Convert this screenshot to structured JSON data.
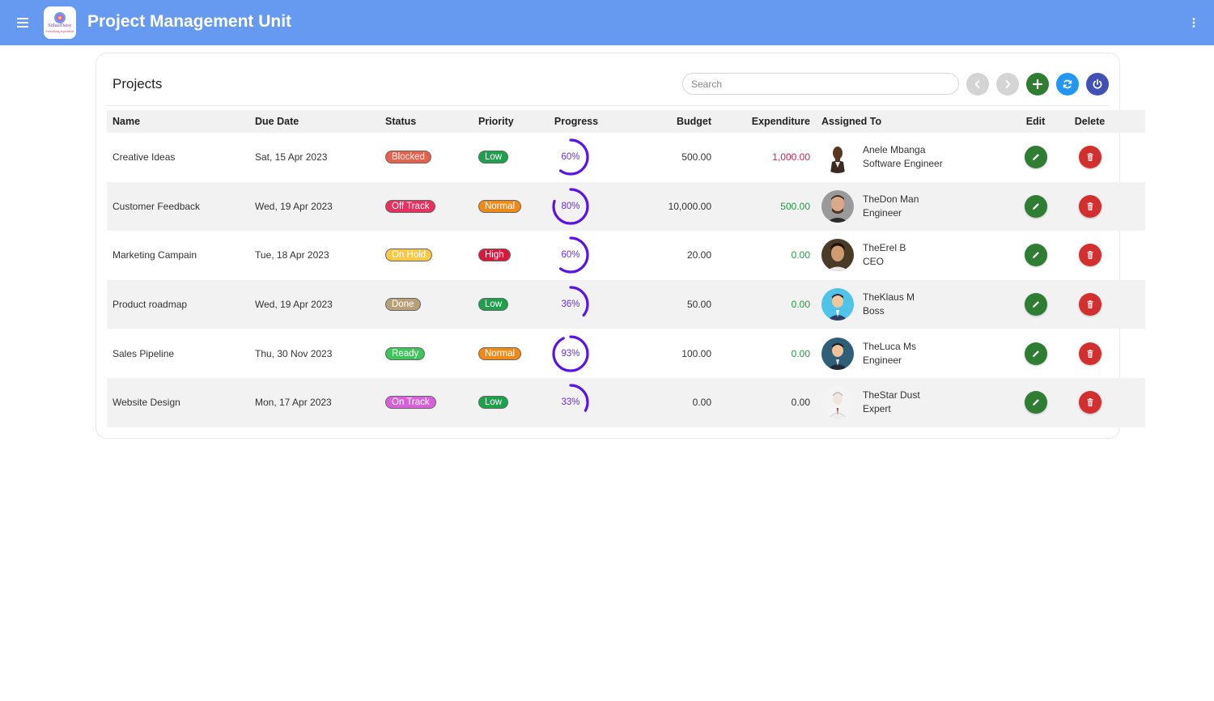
{
  "app": {
    "title": "Project Management Unit",
    "logo_text": "SithaoDaisy",
    "logo_sub": "everything is possible"
  },
  "projects": {
    "title": "Projects",
    "search_placeholder": "Search",
    "toolbar": [
      {
        "name": "prev-page-button",
        "icon": "chevron-left-icon",
        "color": "#d4d4d4"
      },
      {
        "name": "next-page-button",
        "icon": "chevron-right-icon",
        "color": "#d4d4d4"
      },
      {
        "name": "add-project-button",
        "icon": "plus-icon",
        "color": "#2e7d32"
      },
      {
        "name": "refresh-button",
        "icon": "refresh-icon",
        "color": "#2196f3"
      },
      {
        "name": "power-button",
        "icon": "power-icon",
        "color": "#3f51b5"
      }
    ],
    "columns": {
      "name": "Name",
      "due": "Due Date",
      "status": "Status",
      "priority": "Priority",
      "progress": "Progress",
      "budget": "Budget",
      "expenditure": "Expenditure",
      "assigned": "Assigned To",
      "edit": "Edit",
      "delete": "Delete"
    },
    "rows": [
      {
        "name": "Creative Ideas",
        "due": "Sat, 15 Apr 2023",
        "status": {
          "label": "Blocked",
          "color": "#e8604c"
        },
        "priority": {
          "label": "Low",
          "color": "#1aa34a"
        },
        "progress": 60,
        "progress_label": "60%",
        "budget": "500.00",
        "expenditure": "1,000.00",
        "exp_tone": "neg",
        "assignee": {
          "name": "Anele Mbanga",
          "role": "Software Engineer",
          "avatar": "avatar-1"
        }
      },
      {
        "name": "Customer Feedback",
        "due": "Wed, 19 Apr 2023",
        "status": {
          "label": "Off Track",
          "color": "#e8305e"
        },
        "priority": {
          "label": "Normal",
          "color": "#f08a14"
        },
        "progress": 80,
        "progress_label": "80%",
        "budget": "10,000.00",
        "expenditure": "500.00",
        "exp_tone": "pos",
        "assignee": {
          "name": "TheDon Man",
          "role": "Engineer",
          "avatar": "avatar-2"
        }
      },
      {
        "name": "Marketing Campain",
        "due": "Tue, 18 Apr 2023",
        "status": {
          "label": "On Hold",
          "color": "#f7c948"
        },
        "priority": {
          "label": "High",
          "color": "#d9183e"
        },
        "progress": 60,
        "progress_label": "60%",
        "budget": "20.00",
        "expenditure": "0.00",
        "exp_tone": "pos",
        "assignee": {
          "name": "TheErel B",
          "role": "CEO",
          "avatar": "avatar-3"
        }
      },
      {
        "name": "Product roadmap",
        "due": "Wed, 19 Apr 2023",
        "status": {
          "label": "Done",
          "color": "#b8a07a"
        },
        "priority": {
          "label": "Low",
          "color": "#1aa34a"
        },
        "progress": 36,
        "progress_label": "36%",
        "budget": "50.00",
        "expenditure": "0.00",
        "exp_tone": "pos",
        "assignee": {
          "name": "TheKlaus M",
          "role": "Boss",
          "avatar": "avatar-4"
        }
      },
      {
        "name": "Sales Pipeline",
        "due": "Thu, 30 Nov 2023",
        "status": {
          "label": "Ready",
          "color": "#3ec45a"
        },
        "priority": {
          "label": "Normal",
          "color": "#f08a14"
        },
        "progress": 93,
        "progress_label": "93%",
        "budget": "100.00",
        "expenditure": "0.00",
        "exp_tone": "pos",
        "assignee": {
          "name": "TheLuca Ms",
          "role": "Engineer",
          "avatar": "avatar-5"
        }
      },
      {
        "name": "Website Design",
        "due": "Mon, 17 Apr 2023",
        "status": {
          "label": "On Track",
          "color": "#d860d8"
        },
        "priority": {
          "label": "Low",
          "color": "#1aa34a"
        },
        "progress": 33,
        "progress_label": "33%",
        "budget": "0.00",
        "expenditure": "0.00",
        "exp_tone": "plain",
        "assignee": {
          "name": "TheStar Dust",
          "role": "Expert",
          "avatar": "avatar-6"
        }
      }
    ]
  },
  "colors": {
    "header": "#6699f0",
    "progress": "#5b14e6",
    "edit": "#2e7d32",
    "delete": "#d32f2f"
  }
}
